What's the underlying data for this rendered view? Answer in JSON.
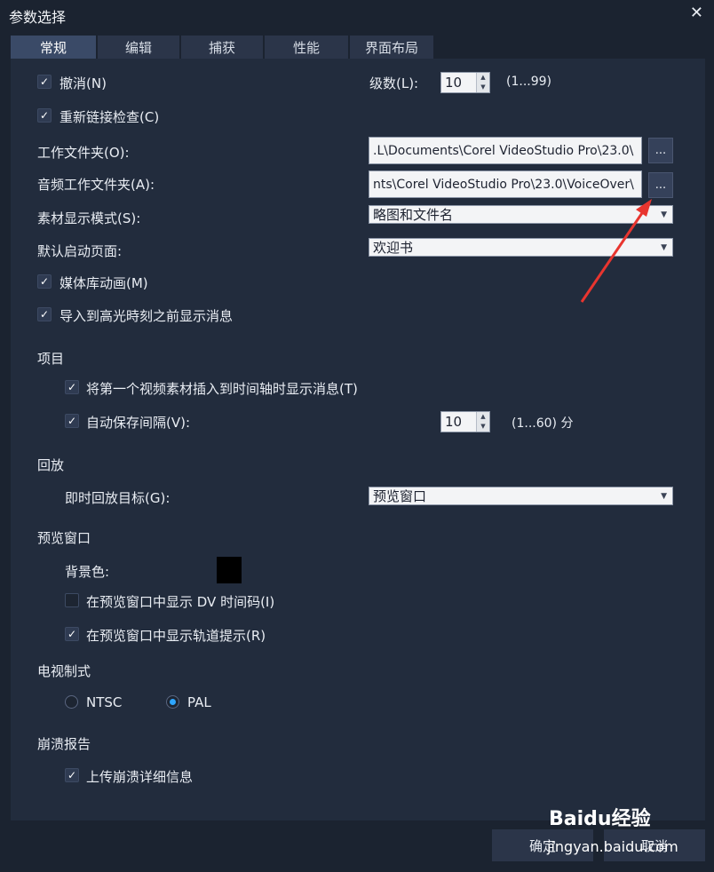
{
  "window": {
    "title": "参数选择",
    "close_icon": "✕"
  },
  "tabs": [
    {
      "label": "常规",
      "active": true
    },
    {
      "label": "编辑"
    },
    {
      "label": "捕获"
    },
    {
      "label": "性能"
    },
    {
      "label": "界面布局"
    }
  ],
  "general": {
    "undo": {
      "label": "撤消(N)",
      "checked": true
    },
    "levels": {
      "label": "级数(L):",
      "value": "10",
      "range": "(1...99)"
    },
    "relink": {
      "label": "重新链接检查(C)",
      "checked": true
    },
    "work_folder": {
      "label": "工作文件夹(O):",
      "value": ".L\\Documents\\Corel VideoStudio Pro\\23.0\\",
      "browse": "..."
    },
    "audio_folder": {
      "label": "音频工作文件夹(A):",
      "value": "nts\\Corel VideoStudio Pro\\23.0\\VoiceOver\\",
      "browse": "..."
    },
    "clip_display": {
      "label": "素材显示模式(S):",
      "value": "略图和文件名"
    },
    "startup_page": {
      "label": "默认启动页面:",
      "value": "欢迎书"
    },
    "library_anim": {
      "label": "媒体库动画(M)",
      "checked": true
    },
    "import_msg": {
      "label": "导入到高光時刻之前显示消息",
      "checked": true
    }
  },
  "project": {
    "heading": "项目",
    "insert_msg": {
      "label": "将第一个视频素材插入到时间轴时显示消息(T)",
      "checked": true
    },
    "autosave": {
      "label": "自动保存间隔(V):",
      "checked": true,
      "value": "10",
      "range": "(1...60) 分"
    }
  },
  "playback": {
    "heading": "回放",
    "target": {
      "label": "即时回放目标(G):",
      "value": "预览窗口"
    }
  },
  "preview": {
    "heading": "预览窗口",
    "bg_color": {
      "label": "背景色:",
      "color": "#000000"
    },
    "dv_timecode": {
      "label": "在预览窗口中显示 DV 时间码(I)",
      "checked": false
    },
    "track_hints": {
      "label": "在预览窗口中显示轨道提示(R)",
      "checked": true
    }
  },
  "tv": {
    "heading": "电视制式",
    "ntsc": "NTSC",
    "pal": "PAL",
    "selected": "PAL"
  },
  "crash": {
    "heading": "崩溃报告",
    "upload": {
      "label": "上传崩溃详细信息",
      "checked": true
    }
  },
  "footer": {
    "ok": "确定",
    "cancel": "取消"
  },
  "watermark": {
    "logo": "Baidu经验",
    "url": "jingyan.baidu.com"
  },
  "colors": {
    "accent": "#2ea6ff",
    "annotation_arrow": "#e8352f"
  }
}
